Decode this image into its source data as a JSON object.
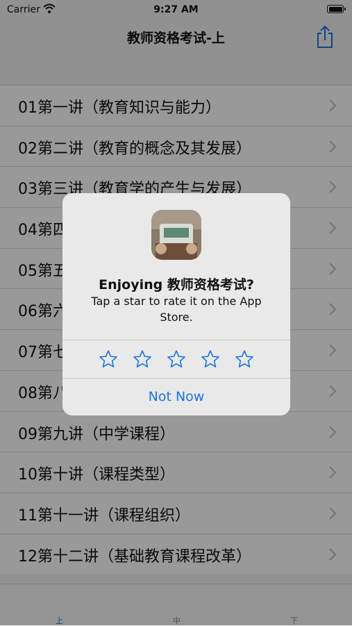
{
  "status_bar": {
    "carrier": "Carrier",
    "time": "9:27 AM"
  },
  "nav": {
    "title": "教师资格考试-上",
    "share_icon": "share-icon"
  },
  "list": [
    {
      "label": "01第一讲（教育知识与能力）"
    },
    {
      "label": "02第二讲（教育的概念及其发展）"
    },
    {
      "label": "03第三讲（教育学的产生与发展）"
    },
    {
      "label": "04第四"
    },
    {
      "label": "05第五"
    },
    {
      "label": "06第六"
    },
    {
      "label": "07第七"
    },
    {
      "label": "08第八"
    },
    {
      "label": "09第九讲（中学课程）"
    },
    {
      "label": "10第十讲（课程类型）"
    },
    {
      "label": "11第十一讲（课程组织）"
    },
    {
      "label": "12第十二讲（基础教育课程改革）"
    }
  ],
  "tabs": [
    {
      "label": "上",
      "active": true
    },
    {
      "label": "中",
      "active": false
    },
    {
      "label": "下",
      "active": false
    }
  ],
  "rating_alert": {
    "title": "Enjoying 教师资格考试?",
    "message": "Tap a star to rate it on the App Store.",
    "rating": 0,
    "max_rating": 5,
    "not_now_label": "Not Now"
  },
  "colors": {
    "accent": "#1a73e8",
    "alert_bg": "#e9e9e9"
  }
}
